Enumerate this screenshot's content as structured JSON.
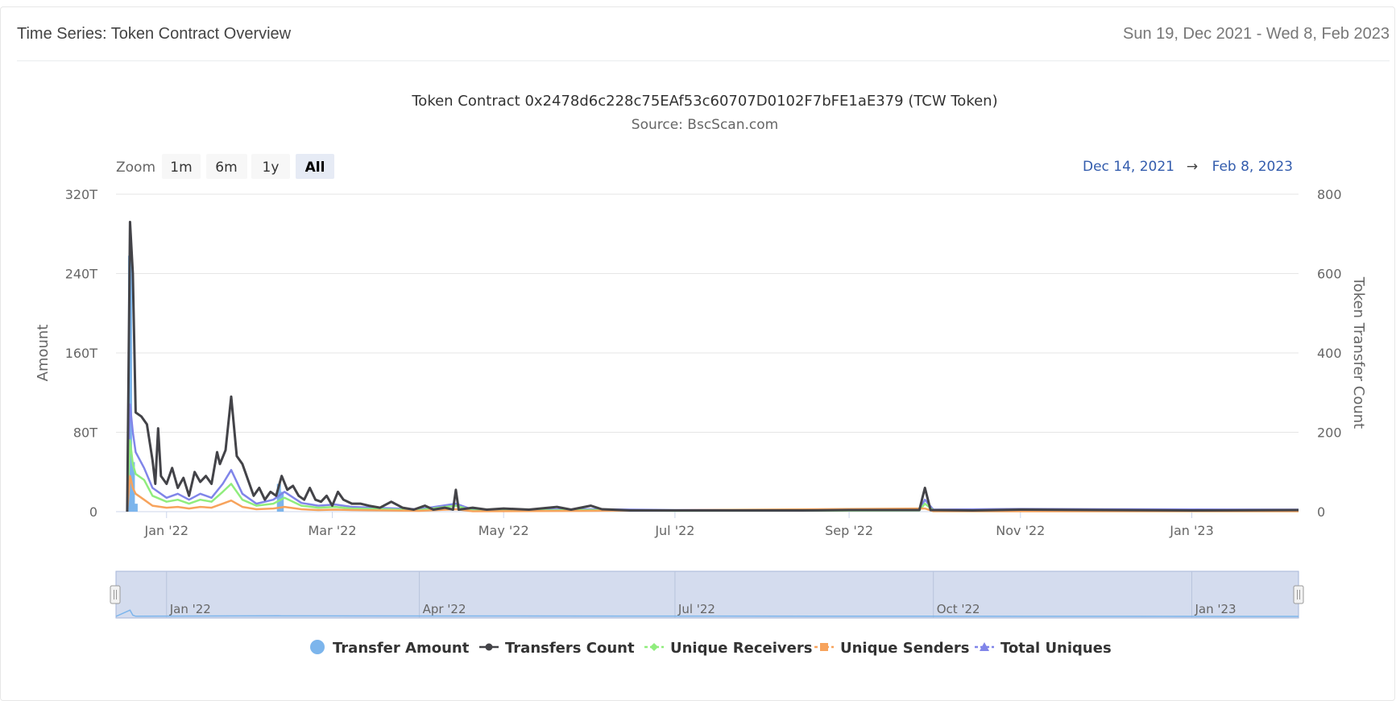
{
  "header": {
    "title": "Time Series: Token Contract Overview",
    "date_range": "Sun 19, Dec 2021 - Wed 8, Feb 2023"
  },
  "chart_data": {
    "type": "line",
    "title": "Token Contract 0x2478d6c228c75EAf53c60707D0102F7bFE1aE379 (TCW Token)",
    "subtitle": "Source: BscScan.com",
    "zoom": {
      "label": "Zoom",
      "buttons": [
        "1m",
        "6m",
        "1y",
        "All"
      ],
      "selected": "All"
    },
    "range": {
      "from": "Dec 14, 2021",
      "arrow": "→",
      "to": "Feb 8, 2023"
    },
    "y_left": {
      "label": "Amount",
      "ticks": [
        "0",
        "80T",
        "160T",
        "240T",
        "320T"
      ],
      "min": 0,
      "max": 320
    },
    "y_right": {
      "label": "Token Transfer Count",
      "ticks": [
        "0",
        "200",
        "400",
        "600",
        "800"
      ],
      "min": 0,
      "max": 800
    },
    "x_ticks": [
      "Jan '22",
      "Mar '22",
      "May '22",
      "Jul '22",
      "Sep '22",
      "Nov '22",
      "Jan '23"
    ],
    "x_tick_dates": [
      "2022-01-01",
      "2022-03-01",
      "2022-05-01",
      "2022-07-01",
      "2022-09-01",
      "2022-11-01",
      "2023-01-01"
    ],
    "x_range": [
      "2021-12-14",
      "2023-02-08"
    ],
    "navigator_ticks": [
      "Jan '22",
      "Apr '22",
      "Jul '22",
      "Oct '22",
      "Jan '23"
    ],
    "navigator_tick_dates": [
      "2022-01-01",
      "2022-04-01",
      "2022-07-01",
      "2022-10-01",
      "2023-01-01"
    ],
    "legend_position": "bottom",
    "grid": true,
    "colors": {
      "transfer_amount": "#7cb5ec",
      "transfers_count": "#434348",
      "unique_receivers": "#90ed7d",
      "unique_senders": "#f7a35c",
      "total_uniques": "#8085e9"
    },
    "series": [
      {
        "name": "Transfer Amount",
        "axis": "left",
        "kind": "column",
        "color": "#7cb5ec",
        "points": [
          [
            "2021-12-19",
            258
          ],
          [
            "2021-12-20",
            50
          ],
          [
            "2021-12-21",
            8
          ],
          [
            "2022-02-10",
            28
          ],
          [
            "2022-02-11",
            20
          ]
        ]
      },
      {
        "name": "Transfers Count",
        "axis": "right",
        "kind": "line",
        "color": "#434348",
        "points": [
          [
            "2021-12-18",
            0
          ],
          [
            "2021-12-19",
            730
          ],
          [
            "2021-12-20",
            600
          ],
          [
            "2021-12-21",
            250
          ],
          [
            "2021-12-23",
            240
          ],
          [
            "2021-12-25",
            220
          ],
          [
            "2021-12-27",
            130
          ],
          [
            "2021-12-28",
            70
          ],
          [
            "2021-12-29",
            210
          ],
          [
            "2021-12-30",
            90
          ],
          [
            "2022-01-01",
            70
          ],
          [
            "2022-01-03",
            110
          ],
          [
            "2022-01-05",
            60
          ],
          [
            "2022-01-07",
            85
          ],
          [
            "2022-01-09",
            40
          ],
          [
            "2022-01-11",
            100
          ],
          [
            "2022-01-13",
            75
          ],
          [
            "2022-01-15",
            90
          ],
          [
            "2022-01-17",
            70
          ],
          [
            "2022-01-19",
            150
          ],
          [
            "2022-01-20",
            120
          ],
          [
            "2022-01-22",
            155
          ],
          [
            "2022-01-24",
            290
          ],
          [
            "2022-01-26",
            140
          ],
          [
            "2022-01-28",
            120
          ],
          [
            "2022-01-30",
            80
          ],
          [
            "2022-02-01",
            40
          ],
          [
            "2022-02-03",
            60
          ],
          [
            "2022-02-05",
            30
          ],
          [
            "2022-02-07",
            50
          ],
          [
            "2022-02-09",
            40
          ],
          [
            "2022-02-11",
            90
          ],
          [
            "2022-02-13",
            55
          ],
          [
            "2022-02-15",
            65
          ],
          [
            "2022-02-17",
            40
          ],
          [
            "2022-02-19",
            30
          ],
          [
            "2022-02-21",
            60
          ],
          [
            "2022-02-23",
            30
          ],
          [
            "2022-02-25",
            25
          ],
          [
            "2022-02-27",
            40
          ],
          [
            "2022-03-01",
            15
          ],
          [
            "2022-03-03",
            50
          ],
          [
            "2022-03-05",
            30
          ],
          [
            "2022-03-08",
            20
          ],
          [
            "2022-03-11",
            20
          ],
          [
            "2022-03-14",
            15
          ],
          [
            "2022-03-18",
            10
          ],
          [
            "2022-03-22",
            25
          ],
          [
            "2022-03-26",
            10
          ],
          [
            "2022-03-30",
            5
          ],
          [
            "2022-04-03",
            15
          ],
          [
            "2022-04-06",
            5
          ],
          [
            "2022-04-10",
            10
          ],
          [
            "2022-04-13",
            5
          ],
          [
            "2022-04-14",
            55
          ],
          [
            "2022-04-15",
            5
          ],
          [
            "2022-04-20",
            10
          ],
          [
            "2022-04-25",
            5
          ],
          [
            "2022-05-01",
            8
          ],
          [
            "2022-05-10",
            5
          ],
          [
            "2022-05-20",
            12
          ],
          [
            "2022-05-25",
            5
          ],
          [
            "2022-06-01",
            15
          ],
          [
            "2022-06-05",
            6
          ],
          [
            "2022-06-15",
            3
          ],
          [
            "2022-07-01",
            3
          ],
          [
            "2022-08-15",
            3
          ],
          [
            "2022-09-01",
            4
          ],
          [
            "2022-09-20",
            4
          ],
          [
            "2022-09-26",
            4
          ],
          [
            "2022-09-28",
            60
          ],
          [
            "2022-09-30",
            4
          ],
          [
            "2022-10-15",
            3
          ],
          [
            "2022-11-01",
            5
          ],
          [
            "2022-12-01",
            4
          ],
          [
            "2023-01-01",
            3
          ],
          [
            "2023-02-08",
            4
          ]
        ]
      },
      {
        "name": "Unique Receivers",
        "axis": "right",
        "kind": "line",
        "color": "#90ed7d",
        "points": [
          [
            "2021-12-18",
            0
          ],
          [
            "2021-12-19",
            180
          ],
          [
            "2021-12-20",
            120
          ],
          [
            "2021-12-21",
            95
          ],
          [
            "2021-12-24",
            80
          ],
          [
            "2021-12-27",
            40
          ],
          [
            "2022-01-01",
            25
          ],
          [
            "2022-01-05",
            30
          ],
          [
            "2022-01-09",
            20
          ],
          [
            "2022-01-13",
            30
          ],
          [
            "2022-01-17",
            25
          ],
          [
            "2022-01-21",
            50
          ],
          [
            "2022-01-24",
            70
          ],
          [
            "2022-01-28",
            30
          ],
          [
            "2022-02-02",
            15
          ],
          [
            "2022-02-08",
            20
          ],
          [
            "2022-02-12",
            35
          ],
          [
            "2022-02-18",
            15
          ],
          [
            "2022-02-24",
            10
          ],
          [
            "2022-03-02",
            12
          ],
          [
            "2022-03-08",
            8
          ],
          [
            "2022-03-20",
            6
          ],
          [
            "2022-04-01",
            4
          ],
          [
            "2022-04-14",
            15
          ],
          [
            "2022-04-20",
            3
          ],
          [
            "2022-05-15",
            3
          ],
          [
            "2022-06-01",
            4
          ],
          [
            "2022-07-01",
            2
          ],
          [
            "2022-09-26",
            3
          ],
          [
            "2022-09-28",
            20
          ],
          [
            "2022-10-01",
            3
          ],
          [
            "2023-02-08",
            3
          ]
        ]
      },
      {
        "name": "Unique Senders",
        "axis": "right",
        "kind": "line",
        "color": "#f7a35c",
        "points": [
          [
            "2021-12-18",
            0
          ],
          [
            "2021-12-19",
            90
          ],
          [
            "2021-12-20",
            60
          ],
          [
            "2021-12-21",
            45
          ],
          [
            "2021-12-24",
            30
          ],
          [
            "2021-12-27",
            15
          ],
          [
            "2022-01-01",
            10
          ],
          [
            "2022-01-05",
            12
          ],
          [
            "2022-01-09",
            8
          ],
          [
            "2022-01-13",
            12
          ],
          [
            "2022-01-17",
            10
          ],
          [
            "2022-01-21",
            20
          ],
          [
            "2022-01-24",
            28
          ],
          [
            "2022-01-28",
            12
          ],
          [
            "2022-02-02",
            6
          ],
          [
            "2022-02-08",
            8
          ],
          [
            "2022-02-12",
            12
          ],
          [
            "2022-02-18",
            6
          ],
          [
            "2022-02-24",
            4
          ],
          [
            "2022-03-02",
            5
          ],
          [
            "2022-03-08",
            4
          ],
          [
            "2022-03-20",
            3
          ],
          [
            "2022-04-01",
            2
          ],
          [
            "2022-04-14",
            6
          ],
          [
            "2022-04-20",
            1
          ],
          [
            "2022-06-01",
            2
          ],
          [
            "2022-09-28",
            8
          ],
          [
            "2022-10-01",
            1
          ],
          [
            "2023-02-08",
            1
          ]
        ]
      },
      {
        "name": "Total Uniques",
        "axis": "right",
        "kind": "line",
        "color": "#8085e9",
        "points": [
          [
            "2021-12-18",
            0
          ],
          [
            "2021-12-19",
            270
          ],
          [
            "2021-12-20",
            200
          ],
          [
            "2021-12-21",
            150
          ],
          [
            "2021-12-24",
            110
          ],
          [
            "2021-12-27",
            60
          ],
          [
            "2022-01-01",
            35
          ],
          [
            "2022-01-05",
            45
          ],
          [
            "2022-01-09",
            30
          ],
          [
            "2022-01-13",
            45
          ],
          [
            "2022-01-17",
            35
          ],
          [
            "2022-01-21",
            70
          ],
          [
            "2022-01-24",
            105
          ],
          [
            "2022-01-28",
            45
          ],
          [
            "2022-02-02",
            20
          ],
          [
            "2022-02-08",
            30
          ],
          [
            "2022-02-12",
            50
          ],
          [
            "2022-02-18",
            22
          ],
          [
            "2022-02-24",
            15
          ],
          [
            "2022-03-02",
            18
          ],
          [
            "2022-03-08",
            12
          ],
          [
            "2022-03-20",
            9
          ],
          [
            "2022-04-01",
            6
          ],
          [
            "2022-04-14",
            20
          ],
          [
            "2022-04-20",
            5
          ],
          [
            "2022-05-15",
            5
          ],
          [
            "2022-06-01",
            6
          ],
          [
            "2022-07-01",
            4
          ],
          [
            "2022-09-26",
            5
          ],
          [
            "2022-09-28",
            30
          ],
          [
            "2022-10-01",
            5
          ],
          [
            "2022-11-01",
            7
          ],
          [
            "2022-12-01",
            6
          ],
          [
            "2023-02-08",
            5
          ]
        ]
      }
    ]
  }
}
